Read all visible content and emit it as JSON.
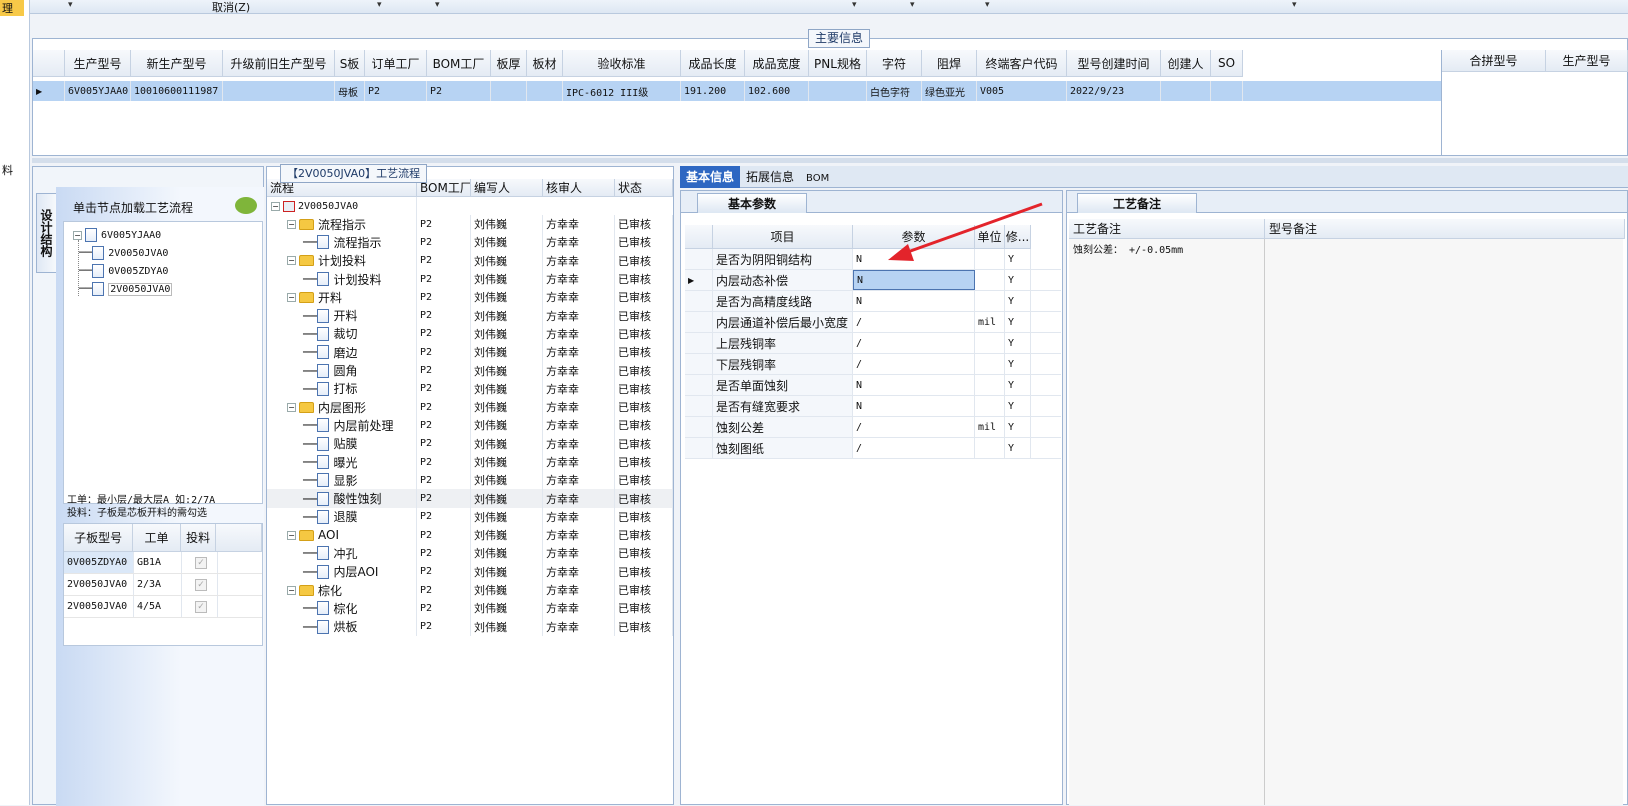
{
  "toolbar": {
    "cancel_label": "取消(Z)",
    "left_tab": "理",
    "left_side_text": "料"
  },
  "main_info": {
    "title": "主要信息",
    "columns": [
      "生产型号",
      "新生产型号",
      "升级前旧生产型号",
      "S板",
      "订单工厂",
      "BOM工厂",
      "板厚",
      "板材",
      "验收标准",
      "成品长度",
      "成品宽度",
      "PNL规格",
      "字符",
      "阻焊",
      "终端客户代码",
      "型号创建时间",
      "创建人",
      "SO"
    ],
    "row": [
      "6V005YJAA0",
      "10010600111987",
      "",
      "母板",
      "P2",
      "P2",
      "",
      "",
      "IPC-6012 III级",
      "191.200",
      "102.600",
      "",
      "白色字符",
      "绿色亚光",
      "V005",
      "2022/9/23",
      "",
      ""
    ],
    "right_columns": [
      "合拼型号",
      "生产型号"
    ]
  },
  "structure": {
    "vtab": "设计结构",
    "title": "单击节点加载工艺流程",
    "tree": [
      {
        "label": "6V005YJAA0"
      },
      {
        "label": "2V0050JVA0"
      },
      {
        "label": "0V005ZDYA0"
      },
      {
        "label": "2V0050JVA0"
      }
    ],
    "note1": "工单：最小层/最大层A 如:2/7A",
    "note2": "投料：子板是芯板开料的需勾选",
    "grid_cols": [
      "子板型号",
      "工单",
      "投料"
    ],
    "grid_rows": [
      [
        "0V005ZDYA0",
        "GB1A"
      ],
      [
        "2V0050JVA0",
        "2/3A"
      ],
      [
        "2V0050JVA0",
        "4/5A"
      ]
    ]
  },
  "flow": {
    "title": "【2V0050JVA0】工艺流程",
    "columns": [
      "流程",
      "BOM工厂",
      "编写人",
      "核审人",
      "状态"
    ],
    "root": "2V0050JVA0",
    "rows": [
      {
        "label": "流程指示",
        "group": true
      },
      {
        "label": "流程指示"
      },
      {
        "label": "计划投料",
        "group": true
      },
      {
        "label": "计划投料"
      },
      {
        "label": "开料",
        "group": true
      },
      {
        "label": "开料"
      },
      {
        "label": "裁切"
      },
      {
        "label": "磨边"
      },
      {
        "label": "圆角"
      },
      {
        "label": "打标"
      },
      {
        "label": "内层图形",
        "group": true
      },
      {
        "label": "内层前处理"
      },
      {
        "label": "贴膜"
      },
      {
        "label": "曝光"
      },
      {
        "label": "显影"
      },
      {
        "label": "酸性蚀刻"
      },
      {
        "label": "退膜"
      },
      {
        "label": "AOI",
        "group": true
      },
      {
        "label": "冲孔"
      },
      {
        "label": "内层AOI"
      },
      {
        "label": "棕化",
        "group": true
      },
      {
        "label": "棕化"
      },
      {
        "label": "烘板"
      }
    ],
    "factory": "P2",
    "writer": "刘伟巍",
    "reviewer": "方幸幸",
    "status": "已审核"
  },
  "tabs": [
    "基本信息",
    "拓展信息",
    "BOM"
  ],
  "params": {
    "title": "基本参数",
    "columns": [
      "项目",
      "参数",
      "单位",
      "修..."
    ],
    "rows": [
      [
        "是否为阴阳铜结构",
        "N",
        "",
        "Y"
      ],
      [
        "内层动态补偿",
        "N",
        "",
        "Y"
      ],
      [
        "是否为高精度线路",
        "N",
        "",
        "Y"
      ],
      [
        "内层通道补偿后最小宽度",
        "/",
        "mil",
        "Y"
      ],
      [
        "上层残铜率",
        "/",
        "",
        "Y"
      ],
      [
        "下层残铜率",
        "/",
        "",
        "Y"
      ],
      [
        "是否单面蚀刻",
        "N",
        "",
        "Y"
      ],
      [
        "是否有缝宽要求",
        "N",
        "",
        "Y"
      ],
      [
        "蚀刻公差",
        "/",
        "mil",
        "Y"
      ],
      [
        "蚀刻图纸",
        "/",
        "",
        "Y"
      ]
    ]
  },
  "remarks": {
    "title": "工艺备注",
    "col1": "工艺备注",
    "col2": "型号备注",
    "text": "蚀刻公差： +/-0.05mm"
  },
  "colors": {
    "selection": "#b7d3f3",
    "arrow": "#e3242b",
    "tab": "#2e67c2"
  }
}
